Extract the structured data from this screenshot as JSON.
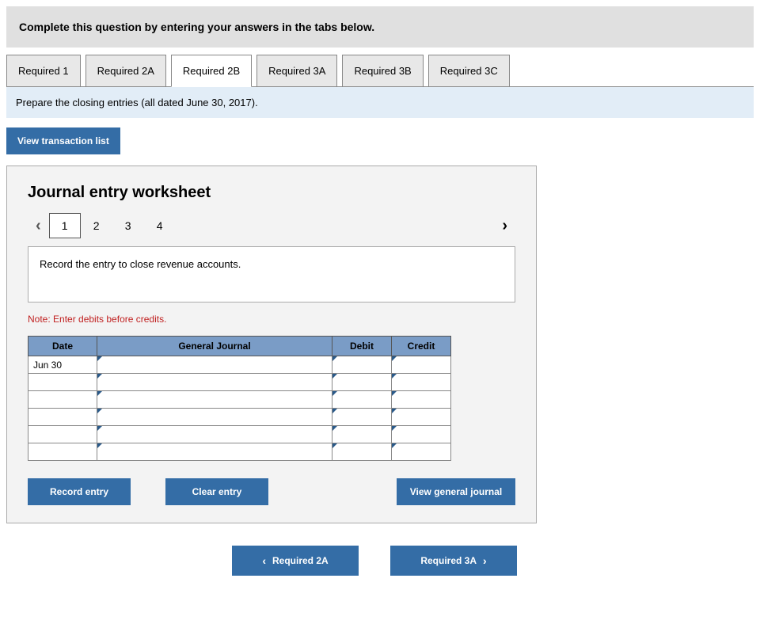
{
  "instruction": "Complete this question by entering your answers in the tabs below.",
  "tabs": [
    {
      "label": "Required 1",
      "active": false
    },
    {
      "label": "Required 2A",
      "active": false
    },
    {
      "label": "Required 2B",
      "active": true
    },
    {
      "label": "Required 3A",
      "active": false
    },
    {
      "label": "Required 3B",
      "active": false
    },
    {
      "label": "Required 3C",
      "active": false
    }
  ],
  "prompt": "Prepare the closing entries (all dated June 30, 2017).",
  "view_transaction_label": "View transaction list",
  "worksheet": {
    "title": "Journal entry worksheet",
    "pages": [
      "1",
      "2",
      "3",
      "4"
    ],
    "active_page": "1",
    "entry_description": "Record the entry to close revenue accounts.",
    "note": "Note: Enter debits before credits.",
    "columns": {
      "date": "Date",
      "general_journal": "General Journal",
      "debit": "Debit",
      "credit": "Credit"
    },
    "rows": [
      {
        "date": "Jun 30",
        "gj": "",
        "debit": "",
        "credit": ""
      },
      {
        "date": "",
        "gj": "",
        "debit": "",
        "credit": ""
      },
      {
        "date": "",
        "gj": "",
        "debit": "",
        "credit": ""
      },
      {
        "date": "",
        "gj": "",
        "debit": "",
        "credit": ""
      },
      {
        "date": "",
        "gj": "",
        "debit": "",
        "credit": ""
      },
      {
        "date": "",
        "gj": "",
        "debit": "",
        "credit": ""
      }
    ],
    "buttons": {
      "record": "Record entry",
      "clear": "Clear entry",
      "view_general": "View general journal"
    }
  },
  "nav": {
    "prev": "Required 2A",
    "next": "Required 3A"
  }
}
